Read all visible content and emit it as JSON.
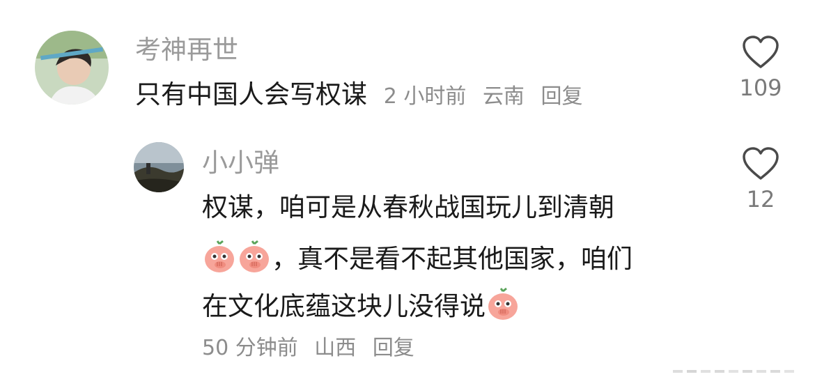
{
  "comments": [
    {
      "username": "考神再世",
      "text": "只有中国人会写权谋",
      "time": "2 小时前",
      "location": "云南",
      "reply_label": "回复",
      "likes": "109"
    }
  ],
  "reply": {
    "username": "小小弹",
    "line1": "权谋，咱可是从春秋战国玩儿到清朝",
    "line2": "，真不是看不起其他国家，咱们",
    "line3": "在文化底蕴这块儿没得说",
    "time": "50 分钟前",
    "location": "山西",
    "reply_label": "回复",
    "likes": "12",
    "emoji_name": "peach-covering-mouth-emoji"
  },
  "colors": {
    "username": "#9a9a9a",
    "text": "#1a1a1a",
    "meta": "#8c8c8c",
    "emoji_peach": "#f7a59a"
  },
  "icons": {
    "like": "heart-outline-icon"
  }
}
